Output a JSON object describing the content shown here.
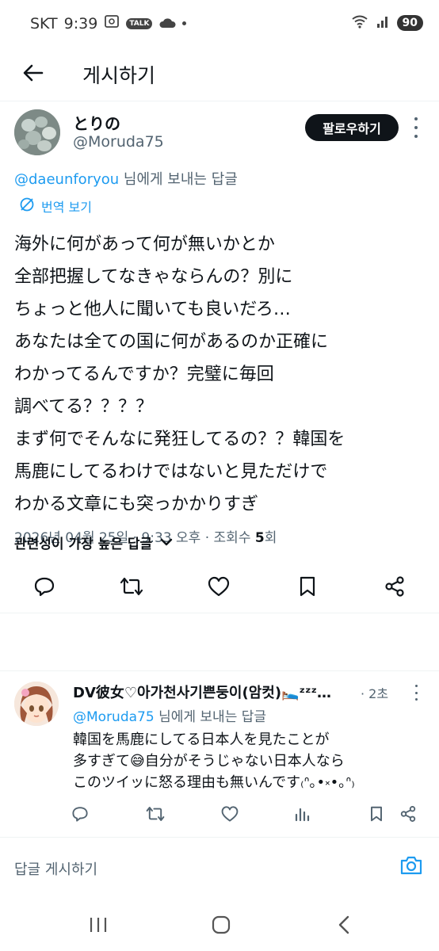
{
  "status_bar": {
    "carrier": "SKT",
    "time": "9:39",
    "notif_talk": "TALK",
    "battery": "90"
  },
  "header": {
    "title": "게시하기"
  },
  "post": {
    "author_name": "とりの",
    "author_handle": "@Moruda75",
    "follow_label": "팔로우하기",
    "reply_to_mention": "@daeunforyou",
    "reply_to_suffix": " 님에게 보내는 답글",
    "translate_label": "번역 보기",
    "body": "海外に何があって何が無いかとか\n全部把握してなきゃならんの？別に\nちょっと他人に聞いても良いだろ…\nあなたは全ての国に何があるのか正確に\nわかってるんですか？完璧に毎回\n調べてる？？？？\nまず何でそんなに発狂してるの？？韓国を\n馬鹿にしてるわけではないと見ただけで\nわかる文章にも突っかかりすぎ",
    "meta_prefix": "2026년 04월 25일 · 9:33 오후 · 조회수 ",
    "view_count": "5",
    "meta_suffix": "회"
  },
  "sort": {
    "label": "관련성이 가장 높은 답글"
  },
  "reply": {
    "author_name": "DV彼女♡아가천사기쁜둥이(암컷)🛌ᶻᶻᶻ…",
    "time": "· 2초",
    "reply_to_mention": "@Moruda75",
    "reply_to_suffix": " 님에게 보내는 답글",
    "body": "韓国を馬鹿にしてる日本人を見たことが\n多すぎて😅自分がそうじゃない日本人なら\nこのツイッに怒る理由も無いんです₍ᐢ｡•༝•｡ᐢ₎"
  },
  "compose": {
    "placeholder": "답글 게시하기"
  },
  "colors": {
    "accent": "#1d9bf0",
    "text": "#0f1419",
    "muted": "#536471"
  }
}
